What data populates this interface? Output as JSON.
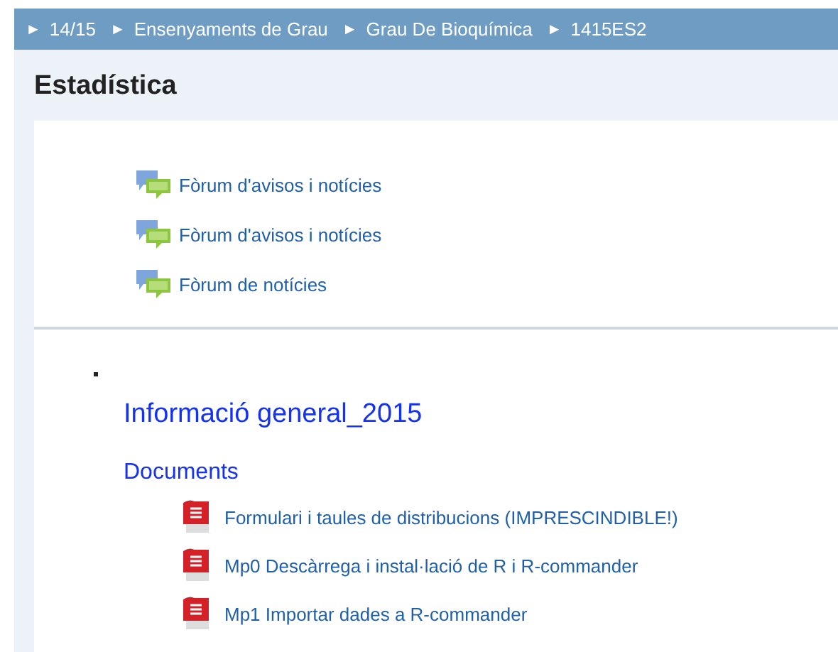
{
  "breadcrumb": [
    {
      "arrow": "►",
      "label": "14/15"
    },
    {
      "arrow": "►",
      "label": "Ensenyaments de Grau"
    },
    {
      "arrow": "►",
      "label": "Grau De Bioquímica"
    },
    {
      "arrow": "►",
      "label": "1415ES2"
    }
  ],
  "course_title": "Estadística",
  "forums": [
    {
      "label": "Fòrum d'avisos i notícies"
    },
    {
      "label": "Fòrum d'avisos i notícies"
    },
    {
      "label": "Fòrum de notícies"
    }
  ],
  "section": {
    "title": "Informació general_2015",
    "subtitle": "Documents",
    "files": [
      {
        "label": "Formulari i taules de distribucions (IMPRESCINDIBLE!)"
      },
      {
        "label": "Mp0 Descàrrega i instal·lació de R i R-commander"
      },
      {
        "label": "Mp1 Importar dades a R-commander"
      }
    ]
  }
}
